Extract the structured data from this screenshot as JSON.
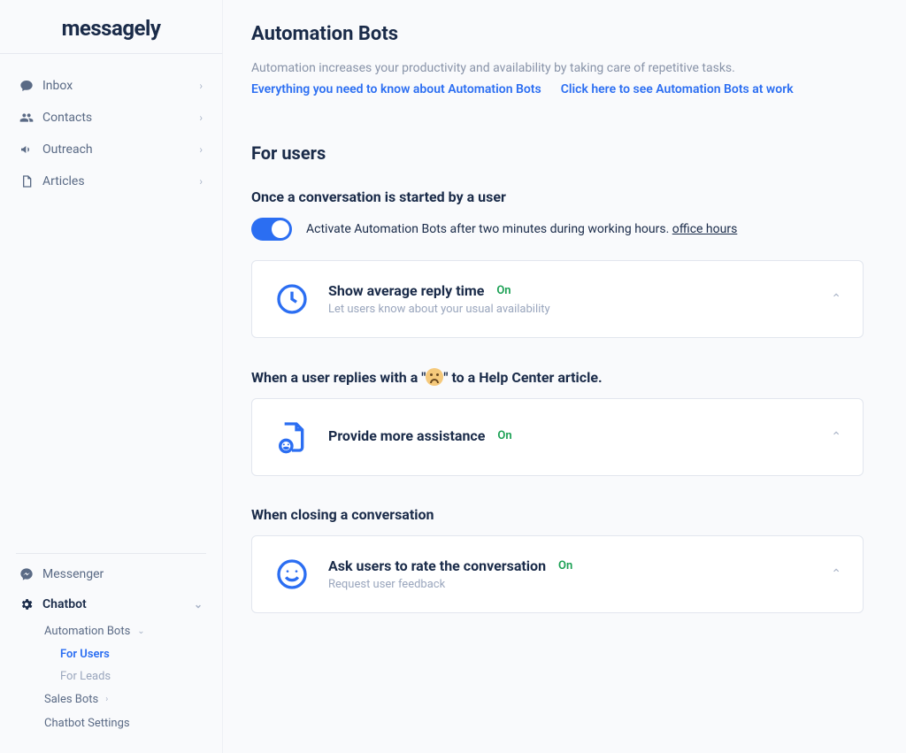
{
  "brand": "messagely",
  "nav": {
    "top": [
      {
        "label": "Inbox"
      },
      {
        "label": "Contacts"
      },
      {
        "label": "Outreach"
      },
      {
        "label": "Articles"
      }
    ],
    "bottom": {
      "messenger": "Messenger",
      "chatbot": "Chatbot",
      "chatbot_children": {
        "automation_bots": "Automation Bots",
        "for_users": "For Users",
        "for_leads": "For Leads",
        "sales_bots": "Sales Bots",
        "settings": "Chatbot Settings"
      }
    }
  },
  "page": {
    "title": "Automation Bots",
    "description": "Automation increases your productivity and availability by taking care of repetitive tasks.",
    "link1": "Everything you need to know about Automation Bots",
    "link2": "Click here to see Automation Bots at work"
  },
  "section": {
    "title": "For users",
    "sub1": "Once a conversation is started by a user",
    "toggle_text_prefix": "Activate Automation Bots after two minutes during working hours. ",
    "toggle_link": "office hours",
    "sub2_prefix": "When a user replies with a \"",
    "sub2_suffix": "\" to a Help Center article.",
    "sub3": "When closing a conversation"
  },
  "cards": {
    "reply_time": {
      "title": "Show average reply time",
      "status": "On",
      "sub": "Let users know about your usual availability"
    },
    "assistance": {
      "title": "Provide more assistance",
      "status": "On"
    },
    "rate": {
      "title": "Ask users to rate the conversation",
      "status": "On",
      "sub": "Request user feedback"
    }
  }
}
